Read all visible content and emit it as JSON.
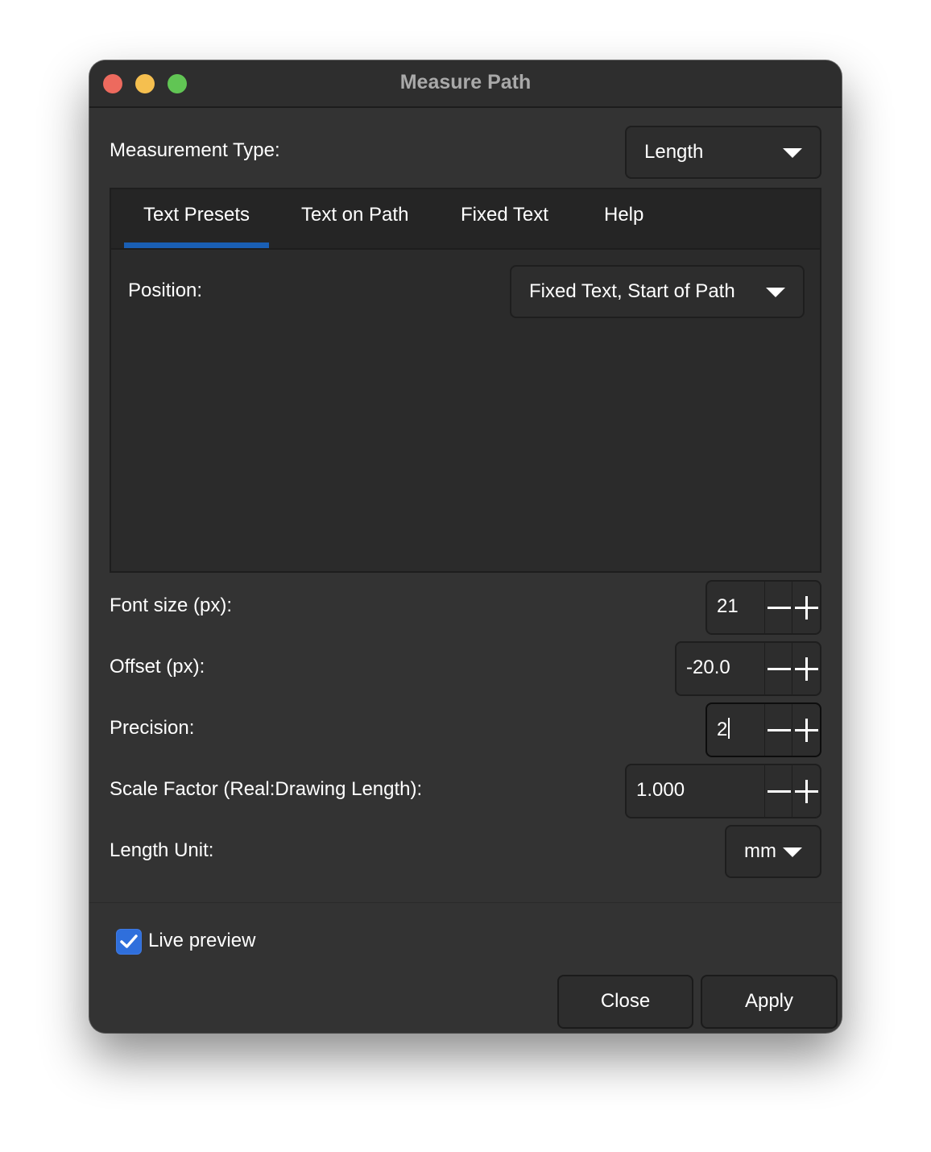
{
  "window": {
    "title": "Measure Path",
    "traffic_lights": [
      "close",
      "minimize",
      "maximize"
    ]
  },
  "measurement_type": {
    "label": "Measurement Type:",
    "value": "Length"
  },
  "tabs": [
    {
      "label": "Text Presets",
      "active": true
    },
    {
      "label": "Text on Path",
      "active": false
    },
    {
      "label": "Fixed Text",
      "active": false
    },
    {
      "label": "Help",
      "active": false
    }
  ],
  "position": {
    "label": "Position:",
    "value": "Fixed Text, Start of Path"
  },
  "font_size": {
    "label": "Font size (px):",
    "value": "21"
  },
  "offset": {
    "label": "Offset (px):",
    "value": "-20.0"
  },
  "precision": {
    "label": "Precision:",
    "value": "2"
  },
  "scale_factor": {
    "label": "Scale Factor (Real:Drawing Length):",
    "value": "1.000"
  },
  "length_unit": {
    "label": "Length Unit:",
    "value": "mm"
  },
  "live_preview": {
    "label": "Live preview",
    "checked": true
  },
  "buttons": {
    "close": "Close",
    "apply": "Apply"
  },
  "colors": {
    "window_bg": "#333333",
    "accent": "#1a5fb4",
    "checkbox": "#2f6fdc"
  }
}
